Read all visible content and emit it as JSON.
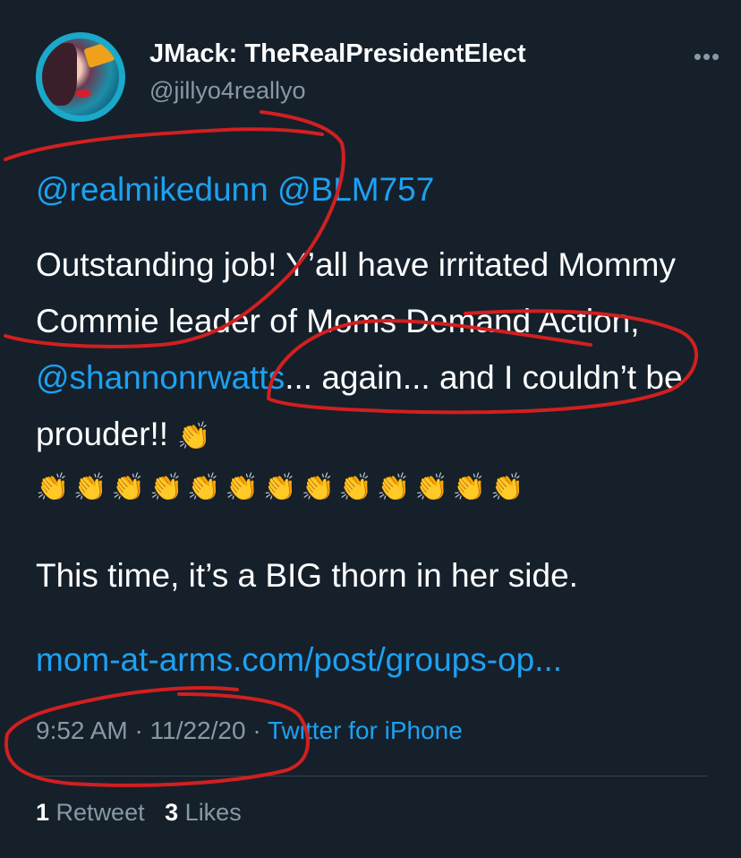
{
  "author": {
    "display_name": "JMack: TheRealPresidentElect",
    "handle": "@jillyo4reallyo",
    "more_icon": "more-icon"
  },
  "tweet": {
    "mentions": [
      "@realmikedunn",
      "@BLM757"
    ],
    "text_part1": "Outstanding job! Y’all have irritated Mommy Commie leader of Moms Demand Action, ",
    "mention_inline": "@shannonrwatts",
    "text_part2": "... again... and I couldn’t be prouder!! ",
    "clap_emoji": "👏",
    "clap_row": "👏👏👏👏👏👏👏👏👏👏👏👏👏",
    "second_paragraph": "This time, it’s a BIG thorn in her side.",
    "link": "mom-at-arms.com/post/groups-op..."
  },
  "meta": {
    "time": "9:52 AM",
    "separator": " · ",
    "date": "11/22/20",
    "source": "Twitter for iPhone"
  },
  "stats": {
    "retweets_count": "1",
    "retweets_label": "Retweet",
    "likes_count": "3",
    "likes_label": "Likes"
  },
  "colors": {
    "background": "#15202b",
    "link": "#1da1f2",
    "secondary_text": "#8899a6",
    "annotation_red": "#d21f1f"
  }
}
